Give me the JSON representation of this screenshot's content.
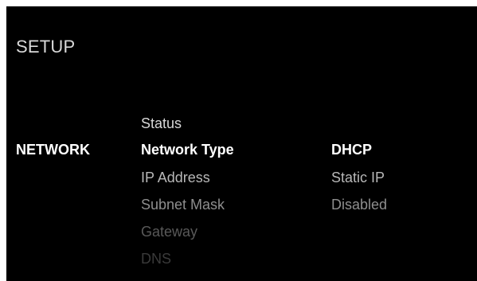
{
  "screen": {
    "title": "SETUP"
  },
  "category": {
    "label": "NETWORK"
  },
  "menu": {
    "items": [
      {
        "label": "Status"
      },
      {
        "label": "Network Type"
      },
      {
        "label": "IP Address"
      },
      {
        "label": "Subnet Mask"
      },
      {
        "label": "Gateway"
      },
      {
        "label": "DNS"
      }
    ]
  },
  "options": {
    "items": [
      {
        "label": "DHCP"
      },
      {
        "label": "Static IP"
      },
      {
        "label": "Disabled"
      }
    ]
  },
  "colors": {
    "background": "#000000",
    "active": "#ffffff",
    "inactive": "#d8d8d8",
    "dimmed": "#595959"
  }
}
